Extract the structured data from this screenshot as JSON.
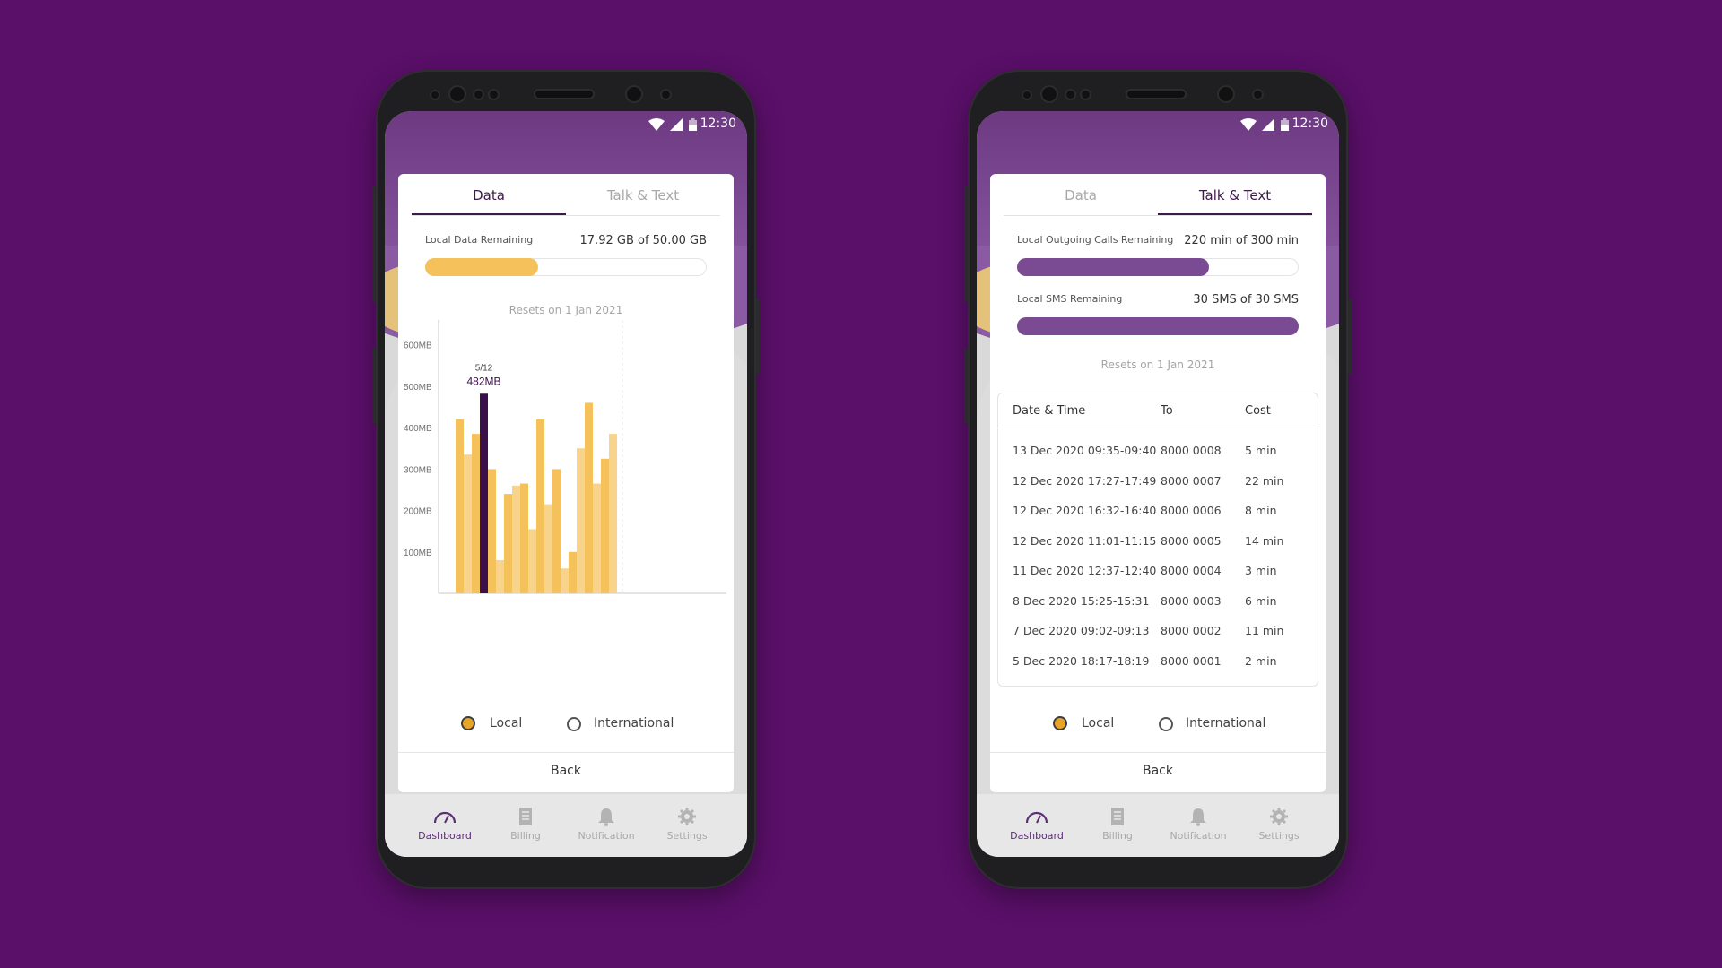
{
  "status_bar": {
    "time": "12:30"
  },
  "tabs": {
    "data": "Data",
    "talk_text": "Talk & Text"
  },
  "left": {
    "data_label": "Local Data Remaining",
    "data_value": "17.92 GB of 50.00 GB",
    "data_fraction": 0.4,
    "resets": "Resets on 1 Jan 2021",
    "chart_data": {
      "type": "bar",
      "ylabel": "",
      "yticks": [
        "100MB",
        "200MB",
        "300MB",
        "400MB",
        "500MB",
        "600MB"
      ],
      "ylim": [
        0,
        660
      ],
      "highlight": {
        "label": "5/12",
        "value_label": "482MB",
        "index": 3
      },
      "values": [
        420,
        335,
        385,
        482,
        300,
        80,
        240,
        260,
        265,
        155,
        420,
        215,
        300,
        60,
        100,
        350,
        460,
        265,
        325,
        385
      ],
      "colors": {
        "bar": "#f5c15b",
        "bar_alt": "#f8d38b",
        "highlight": "#3b0f4a"
      }
    }
  },
  "right": {
    "calls_label": "Local Outgoing Calls Remaining",
    "calls_value": "220 min of 300 min",
    "calls_fraction": 0.68,
    "sms_label": "Local SMS Remaining",
    "sms_value": "30 SMS of 30 SMS",
    "sms_fraction": 1.0,
    "resets": "Resets on 1 Jan 2021",
    "table": {
      "headers": [
        "Date & Time",
        "To",
        "Cost"
      ],
      "rows": [
        [
          "13 Dec 2020 09:35-09:40",
          "8000 0008",
          "5 min"
        ],
        [
          "12 Dec 2020 17:27-17:49",
          "8000 0007",
          "22 min"
        ],
        [
          "12 Dec 2020 16:32-16:40",
          "8000 0006",
          "8 min"
        ],
        [
          "12 Dec 2020 11:01-11:15",
          "8000 0005",
          "14 min"
        ],
        [
          "11 Dec 2020 12:37-12:40",
          "8000 0004",
          "3 min"
        ],
        [
          "8 Dec 2020 15:25-15:31",
          "8000 0003",
          "6 min"
        ],
        [
          "7 Dec 2020 09:02-09:13",
          "8000 0002",
          "11 min"
        ],
        [
          "5 Dec 2020 18:17-18:19",
          "8000 0001",
          "2 min"
        ]
      ]
    }
  },
  "radio": {
    "local": "Local",
    "international": "International"
  },
  "back": "Back",
  "nav": {
    "dashboard": "Dashboard",
    "billing": "Billing",
    "notification": "Notification",
    "settings": "Settings"
  },
  "colors": {
    "background": "#5a0f69",
    "purple": "#7a4a92",
    "gold": "#f5c15b",
    "accent_active": "#5a2f73"
  }
}
